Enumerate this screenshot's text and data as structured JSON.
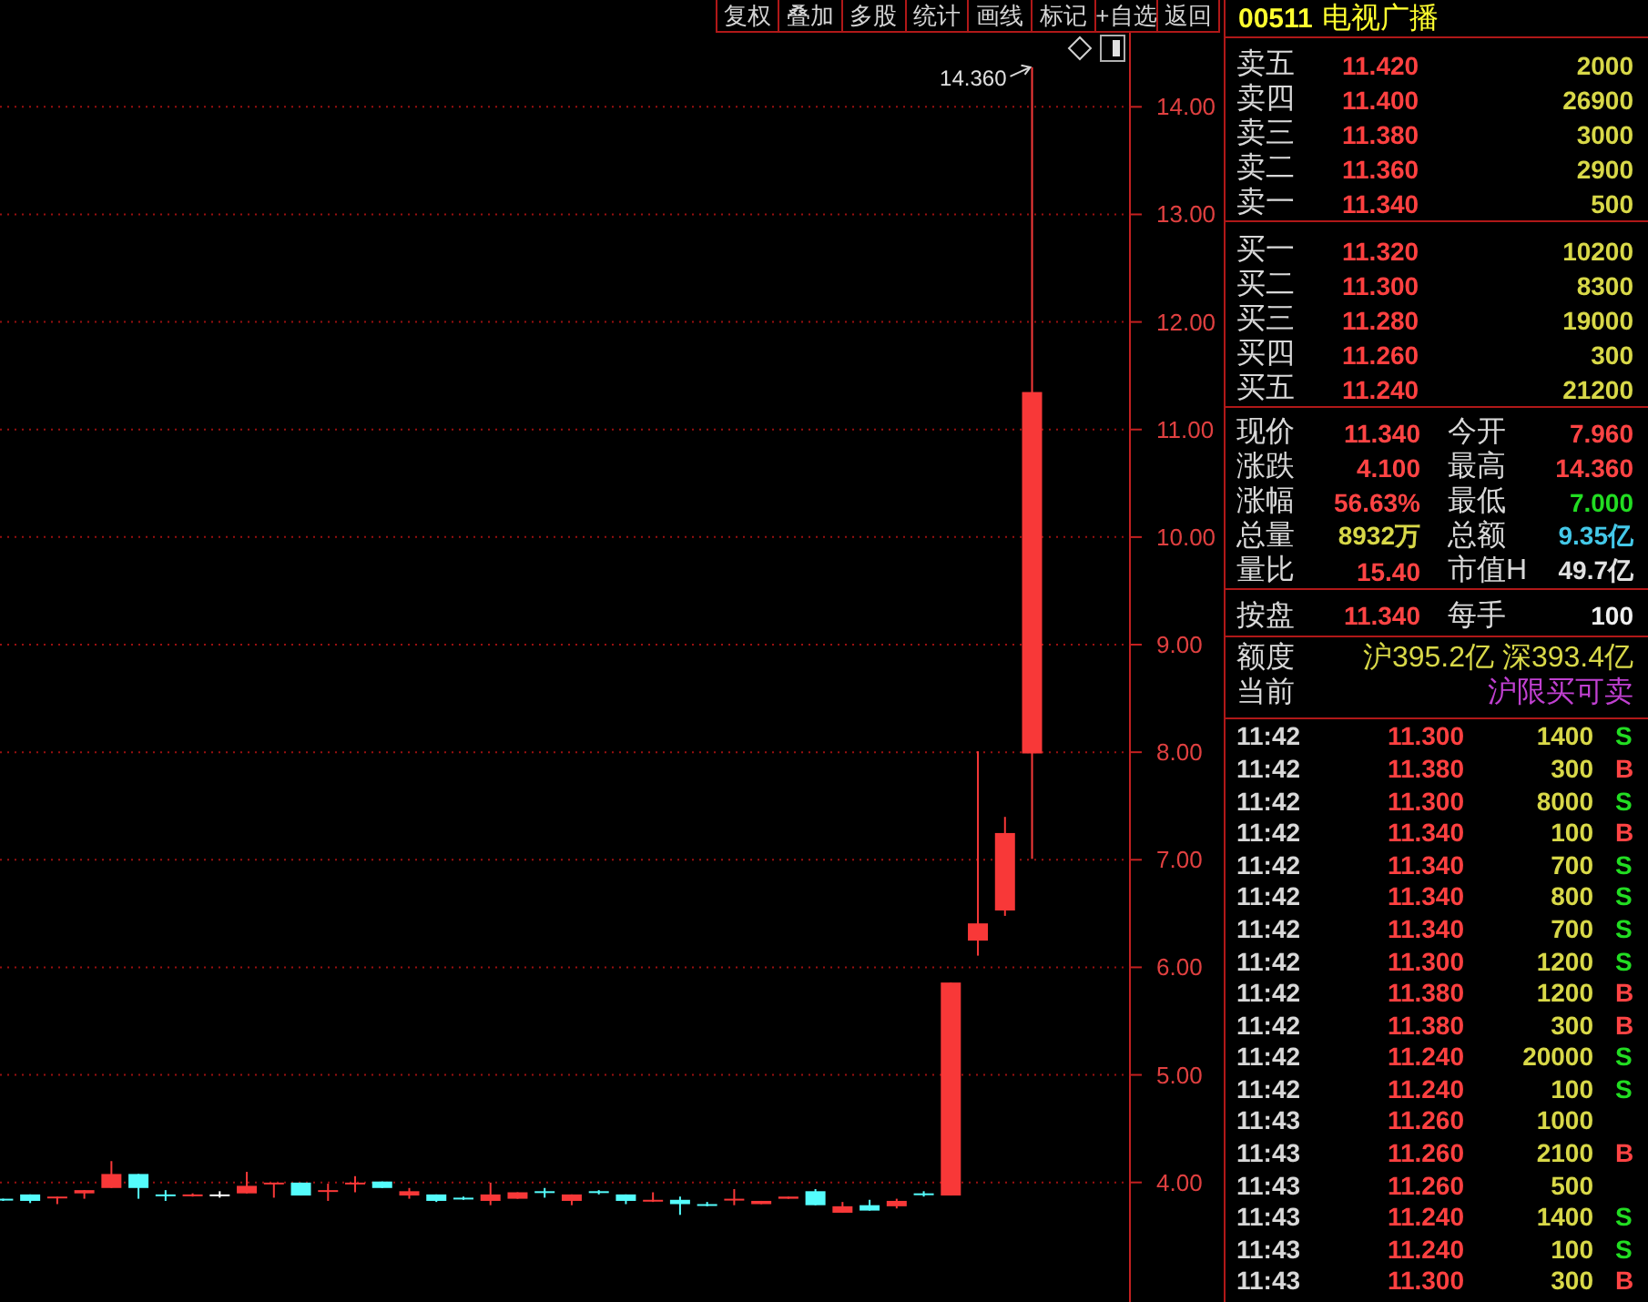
{
  "toolbar": {
    "buttons": [
      "复权",
      "叠加",
      "多股",
      "统计",
      "画线",
      "标记",
      "+自选",
      "返回"
    ]
  },
  "chart": {
    "chart_data": {
      "type": "candlestick",
      "ylim": [
        2.88,
        14.68
      ],
      "grid": true,
      "yticks": [
        {
          "value": 14,
          "label": "14.00"
        },
        {
          "value": 13,
          "label": "13.00"
        },
        {
          "value": 12,
          "label": "12.00"
        },
        {
          "value": 11,
          "label": "11.00"
        },
        {
          "value": 10,
          "label": "10.00"
        },
        {
          "value": 9,
          "label": "9.00"
        },
        {
          "value": 8,
          "label": "8.00"
        },
        {
          "value": 7,
          "label": "7.00"
        },
        {
          "value": 6,
          "label": "6.00"
        },
        {
          "value": 5,
          "label": "5.00"
        },
        {
          "value": 4,
          "label": "4.00"
        }
      ],
      "ohlc": [
        [
          3.84,
          3.84,
          3.82,
          3.83
        ],
        [
          3.88,
          3.88,
          3.8,
          3.82
        ],
        [
          3.85,
          3.86,
          3.79,
          3.86
        ],
        [
          3.89,
          3.92,
          3.84,
          3.92
        ],
        [
          3.94,
          4.19,
          3.94,
          4.07
        ],
        [
          4.07,
          4.07,
          3.84,
          3.94
        ],
        [
          3.88,
          3.92,
          3.82,
          3.87
        ],
        [
          3.87,
          3.89,
          3.86,
          3.88
        ],
        [
          3.88,
          3.91,
          3.85,
          3.88
        ],
        [
          3.89,
          4.09,
          3.89,
          3.96
        ],
        [
          3.98,
          3.99,
          3.85,
          3.99
        ],
        [
          3.99,
          3.99,
          3.87,
          3.87
        ],
        [
          3.91,
          3.98,
          3.82,
          3.92
        ],
        [
          3.98,
          4.05,
          3.9,
          3.99
        ],
        [
          4.0,
          4.0,
          3.94,
          3.94
        ],
        [
          3.87,
          3.94,
          3.84,
          3.91
        ],
        [
          3.88,
          3.88,
          3.81,
          3.82
        ],
        [
          3.85,
          3.86,
          3.83,
          3.84
        ],
        [
          3.82,
          3.99,
          3.78,
          3.88
        ],
        [
          3.84,
          3.9,
          3.84,
          3.9
        ],
        [
          3.91,
          3.94,
          3.85,
          3.9
        ],
        [
          3.82,
          3.88,
          3.78,
          3.88
        ],
        [
          3.91,
          3.92,
          3.88,
          3.9
        ],
        [
          3.88,
          3.88,
          3.79,
          3.82
        ],
        [
          3.82,
          3.9,
          3.81,
          3.83
        ],
        [
          3.83,
          3.86,
          3.69,
          3.79
        ],
        [
          3.79,
          3.81,
          3.77,
          3.78
        ],
        [
          3.83,
          3.93,
          3.78,
          3.84
        ],
        [
          3.79,
          3.82,
          3.79,
          3.82
        ],
        [
          3.84,
          3.86,
          3.84,
          3.86
        ],
        [
          3.91,
          3.93,
          3.78,
          3.78
        ],
        [
          3.71,
          3.81,
          3.71,
          3.77
        ],
        [
          3.78,
          3.83,
          3.73,
          3.73
        ],
        [
          3.77,
          3.84,
          3.75,
          3.82
        ],
        [
          3.89,
          3.91,
          3.86,
          3.88
        ],
        [
          3.87,
          5.85,
          3.87,
          5.85
        ],
        [
          6.24,
          8.0,
          6.1,
          6.4
        ],
        [
          6.52,
          7.39,
          6.47,
          7.24
        ],
        [
          7.98,
          14.36,
          7.0,
          11.34
        ]
      ],
      "annotations": [
        "14.360"
      ]
    }
  },
  "quote": {
    "code": "00511",
    "name": "电视广播",
    "asks": [
      {
        "label": "卖五",
        "price": "11.420",
        "volume": "2000"
      },
      {
        "label": "卖四",
        "price": "11.400",
        "volume": "26900"
      },
      {
        "label": "卖三",
        "price": "11.380",
        "volume": "3000"
      },
      {
        "label": "卖二",
        "price": "11.360",
        "volume": "2900"
      },
      {
        "label": "卖一",
        "price": "11.340",
        "volume": "500"
      }
    ],
    "bids": [
      {
        "label": "买一",
        "price": "11.320",
        "volume": "10200"
      },
      {
        "label": "买二",
        "price": "11.300",
        "volume": "8300"
      },
      {
        "label": "买三",
        "price": "11.280",
        "volume": "19000"
      },
      {
        "label": "买四",
        "price": "11.260",
        "volume": "300"
      },
      {
        "label": "买五",
        "price": "11.240",
        "volume": "21200"
      }
    ],
    "stats": [
      {
        "label": "现价",
        "value": "11.340",
        "color": "#ff4444"
      },
      {
        "label": "今开",
        "value": "7.960",
        "color": "#ff4444"
      },
      {
        "label": "涨跌",
        "value": "4.100",
        "color": "#ff4444"
      },
      {
        "label": "最高",
        "value": "14.360",
        "color": "#ff4444"
      },
      {
        "label": "涨幅",
        "value": "56.63%",
        "color": "#ff4444"
      },
      {
        "label": "最低",
        "value": "7.000",
        "color": "#22dd22"
      },
      {
        "label": "总量",
        "value": "8932万",
        "color": "#d8d848"
      },
      {
        "label": "总额",
        "value": "9.35亿",
        "color": "#44c8e8"
      },
      {
        "label": "量比",
        "value": "15.40",
        "color": "#ff4444"
      },
      {
        "label": "市值H",
        "value": "49.7亿",
        "color": "#e0e0e0"
      }
    ],
    "nominal_row": [
      {
        "label": "按盘",
        "value": "11.340",
        "color": "#ff4444"
      },
      {
        "label": "每手",
        "value": "100",
        "color": "#f0f0f0"
      }
    ],
    "quota": [
      {
        "label": "额度",
        "value": "沪395.2亿 深393.4亿",
        "color": "#d8d848"
      },
      {
        "label": "当前",
        "value": "沪限买可卖",
        "color": "#c040d0"
      }
    ],
    "trades": [
      {
        "time": "11:42",
        "price": "11.300",
        "volume": "1400",
        "flag": {
          "text": "S",
          "color": "#22dd22"
        }
      },
      {
        "time": "11:42",
        "price": "11.380",
        "volume": "300",
        "flag": {
          "text": "B",
          "color": "#ff4444"
        }
      },
      {
        "time": "11:42",
        "price": "11.300",
        "volume": "8000",
        "flag": {
          "text": "S",
          "color": "#22dd22"
        }
      },
      {
        "time": "11:42",
        "price": "11.340",
        "volume": "100",
        "flag": {
          "text": "B",
          "color": "#ff4444"
        }
      },
      {
        "time": "11:42",
        "price": "11.340",
        "volume": "700",
        "flag": {
          "text": "S",
          "color": "#22dd22"
        }
      },
      {
        "time": "11:42",
        "price": "11.340",
        "volume": "800",
        "flag": {
          "text": "S",
          "color": "#22dd22"
        }
      },
      {
        "time": "11:42",
        "price": "11.340",
        "volume": "700",
        "flag": {
          "text": "S",
          "color": "#22dd22"
        }
      },
      {
        "time": "11:42",
        "price": "11.300",
        "volume": "1200",
        "flag": {
          "text": "S",
          "color": "#22dd22"
        }
      },
      {
        "time": "11:42",
        "price": "11.380",
        "volume": "1200",
        "flag": {
          "text": "B",
          "color": "#ff4444"
        }
      },
      {
        "time": "11:42",
        "price": "11.380",
        "volume": "300",
        "flag": {
          "text": "B",
          "color": "#ff4444"
        }
      },
      {
        "time": "11:42",
        "price": "11.240",
        "volume": "20000",
        "flag": {
          "text": "S",
          "color": "#22dd22"
        }
      },
      {
        "time": "11:42",
        "price": "11.240",
        "volume": "100",
        "flag": {
          "text": "S",
          "color": "#22dd22"
        }
      },
      {
        "time": "11:43",
        "price": "11.260",
        "volume": "1000"
      },
      {
        "time": "11:43",
        "price": "11.260",
        "volume": "2100",
        "flag": {
          "text": "B",
          "color": "#ff4444"
        }
      },
      {
        "time": "11:43",
        "price": "11.260",
        "volume": "500"
      },
      {
        "time": "11:43",
        "price": "11.240",
        "volume": "1400",
        "flag": {
          "text": "S",
          "color": "#22dd22"
        }
      },
      {
        "time": "11:43",
        "price": "11.240",
        "volume": "100",
        "flag": {
          "text": "S",
          "color": "#22dd22"
        }
      },
      {
        "time": "11:43",
        "price": "11.300",
        "volume": "300",
        "flag": {
          "text": "B",
          "color": "#ff4444"
        }
      }
    ]
  }
}
